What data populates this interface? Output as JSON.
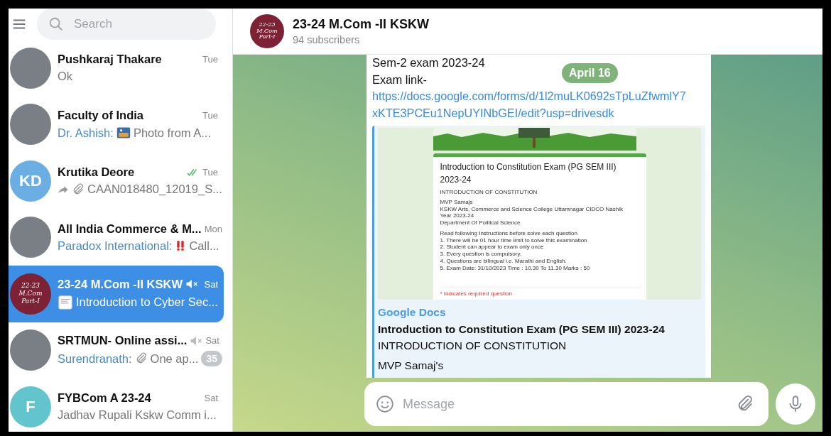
{
  "sidebar": {
    "search": {
      "placeholder": "Search"
    },
    "chats": [
      {
        "name": "Pushkaraj Thakare",
        "time": "Tue",
        "selected": false,
        "muted": false,
        "read": false,
        "avatar": {
          "kind": "photo"
        },
        "preview": [
          {
            "kind": "text",
            "text": "Ok"
          }
        ]
      },
      {
        "name": "Faculty of India",
        "time": "Tue",
        "selected": false,
        "muted": false,
        "read": false,
        "avatar": {
          "kind": "photo"
        },
        "preview": [
          {
            "kind": "sender",
            "text": "Dr. Ashish:"
          },
          {
            "kind": "photo"
          },
          {
            "kind": "text",
            "text": "Photo from A..."
          }
        ]
      },
      {
        "name": "Krutika Deore",
        "time": "Tue",
        "selected": false,
        "muted": false,
        "read": true,
        "avatar": {
          "kind": "initials",
          "text": "KD",
          "color": "#6aaee4"
        },
        "preview": [
          {
            "kind": "forward"
          },
          {
            "kind": "attachment"
          },
          {
            "kind": "text",
            "text": "CAAN018480_12019_S..."
          }
        ]
      },
      {
        "name": "All India Commerce & M...",
        "time": "Mon",
        "selected": false,
        "muted": false,
        "read": false,
        "avatar": {
          "kind": "photo"
        },
        "preview": [
          {
            "kind": "sender",
            "text": "Paradox International:"
          },
          {
            "kind": "alert"
          },
          {
            "kind": "text",
            "text": "Call..."
          }
        ]
      },
      {
        "name": "23-24 M.Com -II KSKW",
        "time": "Sat",
        "selected": true,
        "muted": true,
        "read": false,
        "avatar": {
          "kind": "logo",
          "lines": [
            "22-23",
            "M.Com",
            "Part-I"
          ]
        },
        "preview": [
          {
            "kind": "document"
          },
          {
            "kind": "text",
            "text": "Introduction to Cyber Sec..."
          }
        ]
      },
      {
        "name": "SRTMUN- Online assi...",
        "time": "Sat",
        "selected": false,
        "muted": true,
        "read": false,
        "badge": "35",
        "avatar": {
          "kind": "photo"
        },
        "preview": [
          {
            "kind": "sender",
            "text": "Surendranath:"
          },
          {
            "kind": "attachment"
          },
          {
            "kind": "text",
            "text": "One ap..."
          }
        ]
      },
      {
        "name": "FYBCom A 23-24",
        "time": "Sat",
        "selected": false,
        "muted": false,
        "read": false,
        "avatar": {
          "kind": "initials",
          "text": "F",
          "color": "#62c4cc"
        },
        "preview": [
          {
            "kind": "text",
            "text": "Jadhav Rupali Kskw Comm i..."
          }
        ]
      }
    ]
  },
  "header": {
    "avatar": {
      "lines": [
        "22-23",
        "M.Com",
        "Part-I"
      ]
    },
    "title": "23-24 M.Com -II KSKW",
    "subtitle": "94 subscribers"
  },
  "date_pill": "April 16",
  "message": {
    "lines": [
      "Sem-2 exam 2023-24",
      "Exam link-"
    ],
    "link": "https://docs.google.com/forms/d/1l2muLK0692sTpLuZfwmlY7xKTE3PCEu1NepUYINbGEI/edit?usp=drivesdk",
    "preview": {
      "form": {
        "title": "Introduction to Constitution  Exam (PG SEM III) 2023-24",
        "subtitle": "INTRODUCTION OF CONSTITUTION",
        "lines": [
          "MVP Samajs",
          "KSKW Arts, Commerce and Science College Uttamnagar CIDCO Nashik",
          "Year 2023-24",
          "Department Of Political Science"
        ],
        "instructions": [
          "Read following Instructions before solve each question",
          "1. There will be 01 hour time limit to solve this examination",
          "2. Student can appear to exam only once",
          "3. Every question is compulsory.",
          "4. Questions are bilingual i.e. Marathi and English.",
          "5. Exam Date: 31/10/2023  Time : 10.30 To 11.30  Marks : 50"
        ],
        "required": "* Indicates required question"
      },
      "site": "Google Docs",
      "title": "Introduction to Constitution Exam (PG SEM III) 2023-24",
      "description": [
        "INTRODUCTION OF CONSTITUTION",
        "MVP Samaj's"
      ]
    }
  },
  "composer": {
    "placeholder": "Message"
  }
}
